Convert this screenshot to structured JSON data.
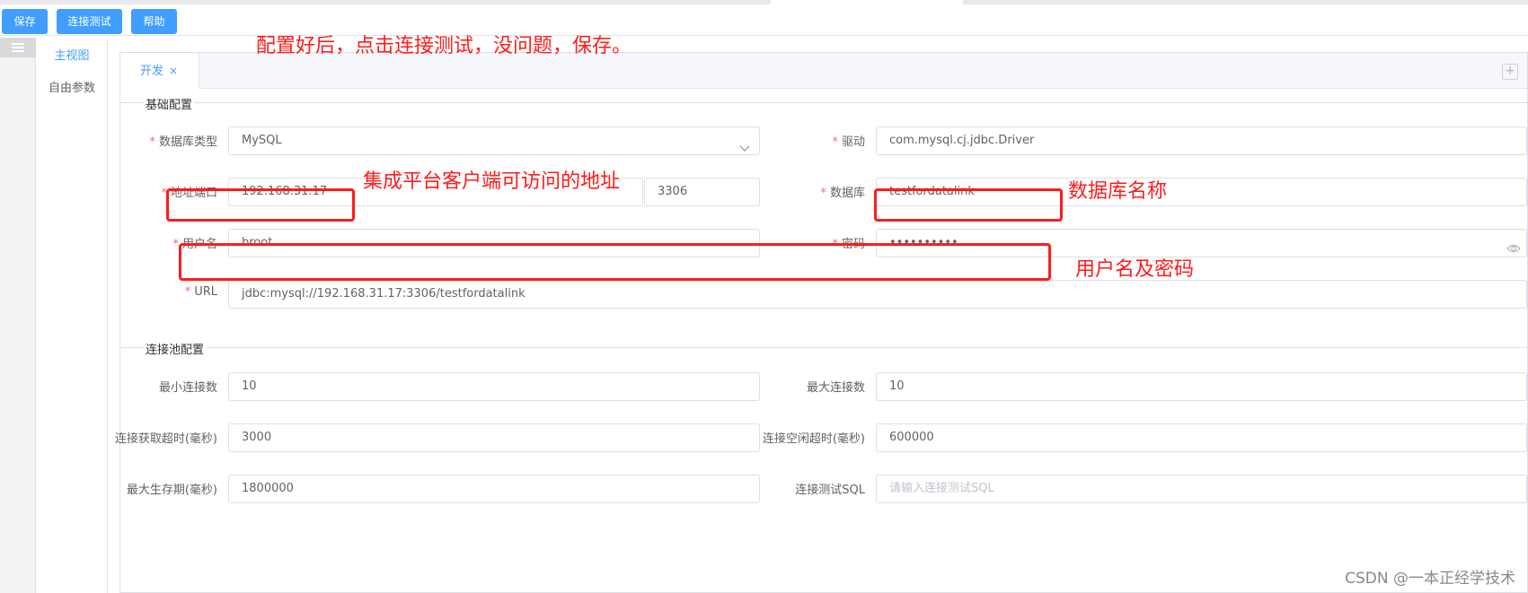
{
  "toolbar": {
    "save": "保存",
    "test_connection": "连接测试",
    "help": "帮助"
  },
  "sidenav": {
    "main_view": "主视图",
    "free_params": "自由参数"
  },
  "tab": {
    "label": "开发",
    "close": "×"
  },
  "add_icon": "+",
  "sections": {
    "basic": "基础配置",
    "pool": "连接池配置"
  },
  "form": {
    "db_type": {
      "label": "数据库类型",
      "value": "MySQL"
    },
    "driver": {
      "label": "驱动",
      "value": "com.mysql.cj.jdbc.Driver"
    },
    "address": {
      "label": "地址端口",
      "host": "192.168.31.17",
      "port": "3306"
    },
    "database": {
      "label": "数据库",
      "value": "testfordatalink"
    },
    "username": {
      "label": "用户名",
      "value": "broot"
    },
    "password": {
      "label": "密码",
      "value": "••••••••••"
    },
    "url": {
      "label": "URL",
      "value": "jdbc:mysql://192.168.31.17:3306/testfordatalink"
    },
    "min_conn": {
      "label": "最小连接数",
      "value": "10"
    },
    "max_conn": {
      "label": "最大连接数",
      "value": "10"
    },
    "acquire_timeout": {
      "label": "连接获取超时(毫秒)",
      "value": "3000"
    },
    "idle_timeout": {
      "label": "连接空闲超时(毫秒)",
      "value": "600000"
    },
    "max_lifetime": {
      "label": "最大生存期(毫秒)",
      "value": "1800000"
    },
    "test_sql": {
      "label": "连接测试SQL",
      "placeholder": "请输入连接测试SQL"
    }
  },
  "required_mark": "*",
  "annotations": {
    "top": "配置好后，点击连接测试，没问题，保存。",
    "address": "集成平台客户端可访问的地址",
    "database": "数据库名称",
    "credentials": "用户名及密码"
  },
  "watermark": "CSDN @一本正经学技术",
  "colors": {
    "primary": "#409eff",
    "annotation": "#ff1b1b",
    "required": "#f56c6c"
  },
  "icons": {
    "menu": "menu-icon",
    "chevron": "chevron-down-icon",
    "eye": "eye-icon",
    "close": "close-icon",
    "add": "plus-icon"
  }
}
